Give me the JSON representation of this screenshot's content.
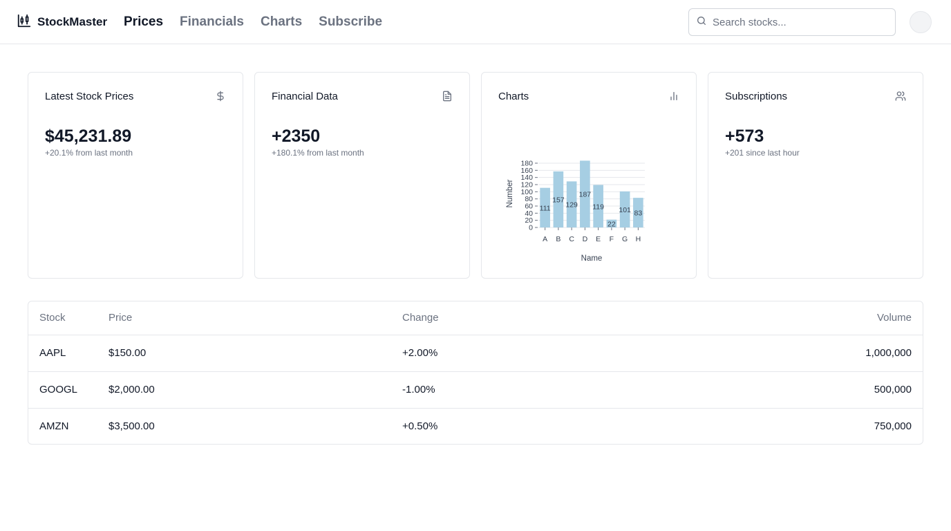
{
  "header": {
    "brand": "StockMaster",
    "nav": [
      {
        "label": "Prices",
        "active": true
      },
      {
        "label": "Financials",
        "active": false
      },
      {
        "label": "Charts",
        "active": false
      },
      {
        "label": "Subscribe",
        "active": false
      }
    ],
    "search": {
      "placeholder": "Search stocks...",
      "value": ""
    }
  },
  "cards": [
    {
      "title": "Latest Stock Prices",
      "icon": "dollar-icon",
      "value": "$45,231.89",
      "sub": "+20.1% from last month"
    },
    {
      "title": "Financial Data",
      "icon": "document-icon",
      "value": "+2350",
      "sub": "+180.1% from last month"
    },
    {
      "title": "Charts",
      "icon": "bar-chart-icon"
    },
    {
      "title": "Subscriptions",
      "icon": "users-icon",
      "value": "+573",
      "sub": "+201 since last hour"
    }
  ],
  "chart_data": {
    "type": "bar",
    "categories": [
      "A",
      "B",
      "C",
      "D",
      "E",
      "F",
      "G",
      "H"
    ],
    "values": [
      111,
      157,
      129,
      187,
      119,
      22,
      101,
      83
    ],
    "xlabel": "Name",
    "ylabel": "Number",
    "ylim": [
      0,
      180
    ],
    "yticks": [
      0,
      20,
      40,
      60,
      80,
      100,
      120,
      140,
      160,
      180
    ],
    "grid": true,
    "bar_color": "#a6cee3",
    "data_labels": true
  },
  "table": {
    "columns": [
      "Stock",
      "Price",
      "Change",
      "Volume"
    ],
    "rows": [
      {
        "stock": "AAPL",
        "price": "$150.00",
        "change": "+2.00%",
        "volume": "1,000,000"
      },
      {
        "stock": "GOOGL",
        "price": "$2,000.00",
        "change": "-1.00%",
        "volume": "500,000"
      },
      {
        "stock": "AMZN",
        "price": "$3,500.00",
        "change": "+0.50%",
        "volume": "750,000"
      }
    ]
  },
  "colors": {
    "text": "#111827",
    "muted": "#6b7280",
    "border": "#e5e7eb"
  }
}
